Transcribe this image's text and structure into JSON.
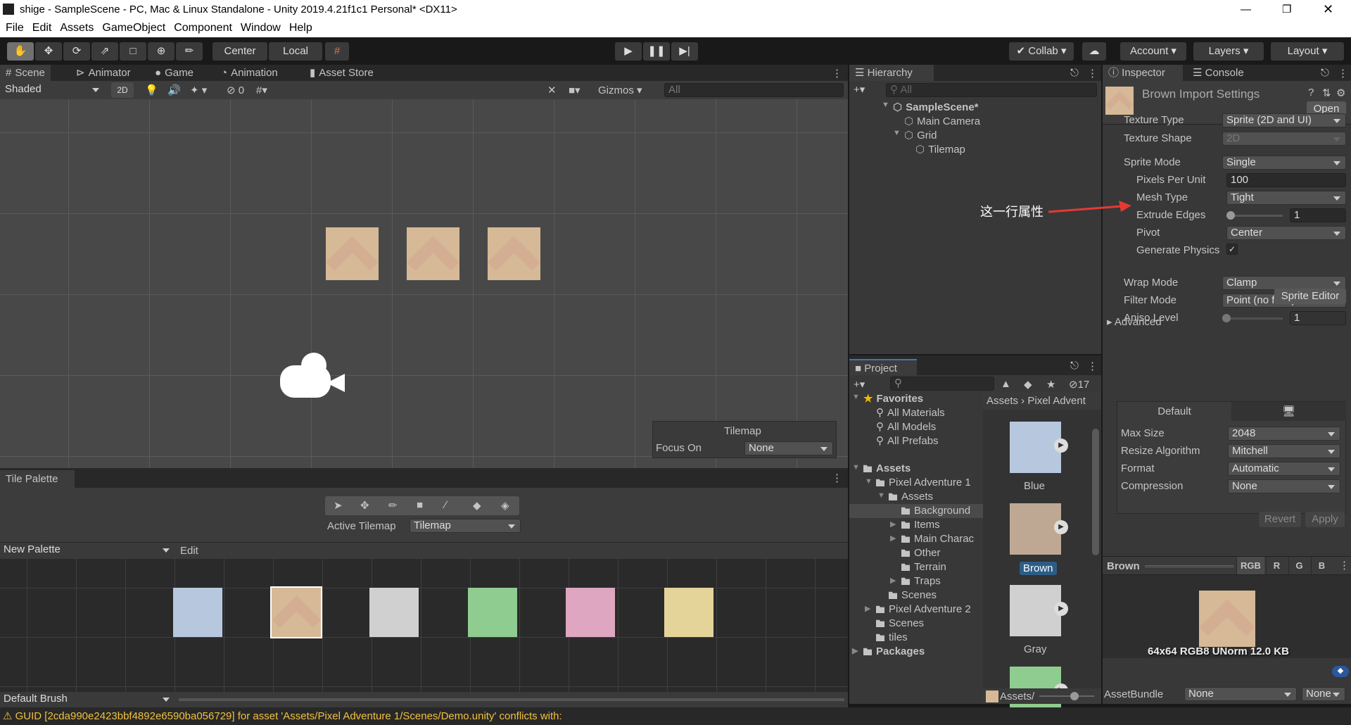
{
  "window": {
    "title": "shige - SampleScene - PC, Mac & Linux Standalone - Unity 2019.4.21f1c1 Personal* <DX11>"
  },
  "menu": [
    "File",
    "Edit",
    "Assets",
    "GameObject",
    "Component",
    "Window",
    "Help"
  ],
  "toolbar": {
    "pivot": "Center",
    "space": "Local",
    "collab": "Collab",
    "account": "Account",
    "layers": "Layers",
    "layout": "Layout"
  },
  "scene_tabs": [
    "Scene",
    "Animator",
    "Game",
    "Animation",
    "Asset Store"
  ],
  "scene_toolbar": {
    "shading": "Shaded",
    "mode_2d": "2D",
    "hidden_count": "0",
    "gizmos": "Gizmos",
    "search_placeholder": "All"
  },
  "tilemap_overlay": {
    "title": "Tilemap",
    "focus_label": "Focus On",
    "focus_value": "None"
  },
  "tile_palette": {
    "tab": "Tile Palette",
    "active_tilemap_label": "Active Tilemap",
    "active_tilemap": "Tilemap",
    "palette": "New Palette",
    "edit": "Edit",
    "brush": "Default Brush",
    "tile_colors": [
      "#b7c8de",
      "#d6b996",
      "#d0d0d0",
      "#8fcc8f",
      "#dea6c0",
      "#e4d49a"
    ]
  },
  "hierarchy": {
    "tab": "Hierarchy",
    "search_placeholder": "All",
    "items": [
      {
        "label": "SampleScene*",
        "depth": 0
      },
      {
        "label": "Main Camera",
        "depth": 1
      },
      {
        "label": "Grid",
        "depth": 1
      },
      {
        "label": "Tilemap",
        "depth": 2
      }
    ]
  },
  "project": {
    "tab": "Project",
    "hidden_count": "17",
    "breadcrumb": [
      "Assets",
      "Pixel Advent"
    ],
    "footer_path": "Assets/",
    "tree": [
      {
        "label": "Favorites",
        "depth": 0,
        "bold": true
      },
      {
        "label": "All Materials",
        "depth": 1
      },
      {
        "label": "All Models",
        "depth": 1
      },
      {
        "label": "All Prefabs",
        "depth": 1
      },
      {
        "label": "",
        "depth": 0
      },
      {
        "label": "Assets",
        "depth": 0,
        "bold": true
      },
      {
        "label": "Pixel Adventure 1",
        "depth": 1
      },
      {
        "label": "Assets",
        "depth": 2
      },
      {
        "label": "Background",
        "depth": 3,
        "selected": true
      },
      {
        "label": "Items",
        "depth": 3
      },
      {
        "label": "Main Charac",
        "depth": 3
      },
      {
        "label": "Other",
        "depth": 3
      },
      {
        "label": "Terrain",
        "depth": 3
      },
      {
        "label": "Traps",
        "depth": 3
      },
      {
        "label": "Scenes",
        "depth": 2
      },
      {
        "label": "Pixel Adventure 2",
        "depth": 1
      },
      {
        "label": "Scenes",
        "depth": 1
      },
      {
        "label": "tiles",
        "depth": 1
      },
      {
        "label": "Packages",
        "depth": 0,
        "bold": true
      }
    ],
    "assets": [
      {
        "label": "Blue",
        "color": "#b7c8de"
      },
      {
        "label": "Brown",
        "color": "#bfa893",
        "selected": true
      },
      {
        "label": "Gray",
        "color": "#d0d0d0"
      },
      {
        "label": "",
        "color": "#8fcc8f"
      }
    ]
  },
  "inspector": {
    "tab": "Inspector",
    "console_tab": "Console",
    "title": "Brown Import Settings",
    "open": "Open",
    "rows": [
      {
        "label": "Texture Type",
        "value": "Sprite (2D and UI)"
      },
      {
        "label": "Texture Shape",
        "value": "2D",
        "disabled": true
      },
      {
        "label": "Sprite Mode",
        "value": "Single"
      },
      {
        "label": "Pixels Per Unit",
        "value": "100"
      },
      {
        "label": "Mesh Type",
        "value": "Tight"
      },
      {
        "label": "Extrude Edges",
        "value": "1"
      },
      {
        "label": "Pivot",
        "value": "Center"
      },
      {
        "label": "Generate Physics",
        "value": "checked"
      }
    ],
    "sprite_editor": "Sprite Editor",
    "advanced": "Advanced",
    "rows2": [
      {
        "label": "Wrap Mode",
        "value": "Clamp"
      },
      {
        "label": "Filter Mode",
        "value": "Point (no filter)"
      },
      {
        "label": "Aniso Level",
        "value": "1",
        "disabled": true
      }
    ],
    "platform_tab": "Default",
    "platform_rows": [
      {
        "label": "Max Size",
        "value": "2048"
      },
      {
        "label": "Resize Algorithm",
        "value": "Mitchell"
      },
      {
        "label": "Format",
        "value": "Automatic"
      },
      {
        "label": "Compression",
        "value": "None"
      }
    ],
    "revert": "Revert",
    "apply": "Apply",
    "preview": {
      "name": "Brown",
      "channels": [
        "RGB",
        "R",
        "G",
        "B"
      ],
      "info": "64x64  RGB8 UNorm   12.0 KB"
    },
    "asset_bundle": {
      "label": "AssetBundle",
      "value": "None",
      "variant": "None"
    }
  },
  "annotation": {
    "text": "这一行属性",
    "color": "#e53935"
  },
  "status": {
    "message": "GUID [2cda990e2423bbf4892e6590ba056729] for asset 'Assets/Pixel Adventure 1/Scenes/Demo.unity' conflicts with:",
    "color": "#f0c040"
  }
}
